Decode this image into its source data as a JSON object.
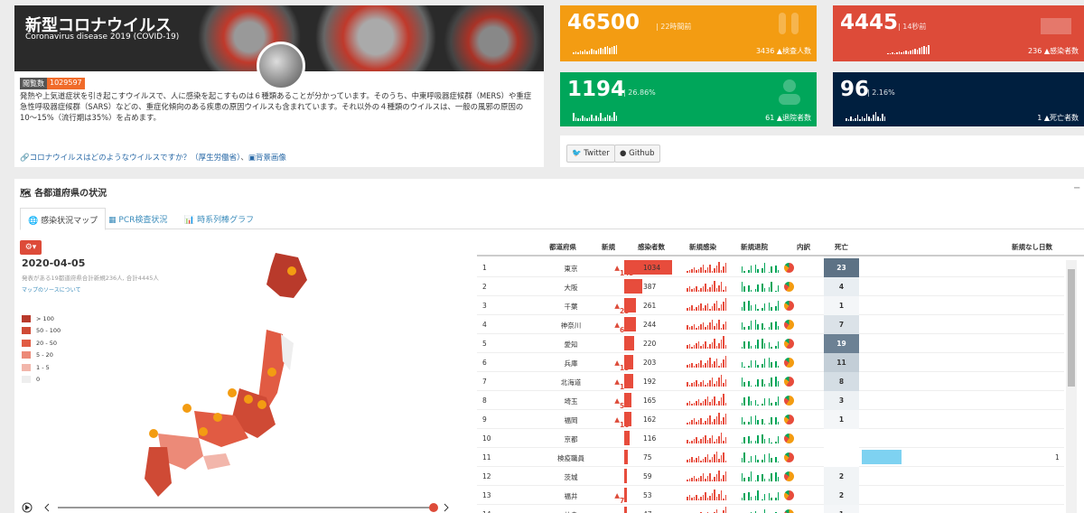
{
  "header": {
    "title": "新型コロナウイルス",
    "subtitle": "Coronavirus disease 2019 (COVID-19)",
    "views_label": "閲覧数",
    "views_count": "1029597",
    "description": "発熱や上気道症状を引き起こすウイルスで、人に感染を起こすものは６種類あることが分かっています。そのうち、中東呼吸器症候群（MERS）や重症急性呼吸器症候群（SARS）などの、重症化傾向のある疾患の原因ウイルスも含まれています。それ以外の４種類のウイルスは、一般の風邪の原因の10〜15%（流行期は35%）を占めます。",
    "link1": "コロナウイルスはどのようなウイルスですか？（厚生労働省）",
    "sep": "、",
    "link2": "背景画像"
  },
  "stats": [
    {
      "value": "46500",
      "sub": "22時間前",
      "foot_num": "3436",
      "foot_label": "検査人数",
      "color": "#f39c12",
      "spark": [
        2,
        3,
        2,
        4,
        3,
        5,
        3,
        4,
        6,
        5,
        4,
        6,
        7,
        6,
        8,
        9,
        7,
        8,
        9,
        10
      ]
    },
    {
      "value": "4445",
      "sub": "14秒前",
      "foot_num": "236",
      "foot_label": "感染者数",
      "color": "#dd4b39",
      "spark": [
        1,
        1,
        2,
        1,
        2,
        3,
        2,
        3,
        4,
        3,
        4,
        5,
        6,
        5,
        7,
        8,
        9,
        8,
        10
      ]
    },
    {
      "value": "1194",
      "sub": "26.86%",
      "foot_num": "61",
      "foot_label": "退院者数",
      "color": "#00a65a",
      "spark": [
        6,
        3,
        2,
        2,
        4,
        3,
        2,
        3,
        5,
        2,
        4,
        3,
        6,
        2,
        3,
        5,
        4,
        3,
        7,
        4
      ]
    },
    {
      "value": "96",
      "sub": "2.16%",
      "foot_num": "1",
      "foot_label": "死亡者数",
      "color": "#001f3f",
      "spark": [
        2,
        1,
        3,
        1,
        2,
        4,
        1,
        3,
        2,
        5,
        3,
        2,
        4,
        6,
        3,
        2,
        5,
        3
      ]
    }
  ],
  "social": {
    "twitter": "Twitter",
    "github": "Github"
  },
  "panel": {
    "title": "各都道府県の状況",
    "tabs": [
      "感染状況マップ",
      "PCR検査状況",
      "時系列棒グラフ"
    ],
    "minimize": "−"
  },
  "map": {
    "date": "2020-04-05",
    "desc": "発表がある19都道府県合計新規236人, 合計4445人",
    "source_link": "マップのソースについて",
    "gear": "⚙▾",
    "legend": [
      {
        "label": "> 100",
        "color": "#b93a2b"
      },
      {
        "label": "50 - 100",
        "color": "#cf4a35"
      },
      {
        "label": "20 - 50",
        "color": "#e15b43"
      },
      {
        "label": "5 - 20",
        "color": "#ec8a78"
      },
      {
        "label": "1 - 5",
        "color": "#f2b6ab"
      },
      {
        "label": "0",
        "color": "#eeeeee"
      }
    ]
  },
  "table": {
    "headers": {
      "pref": "都道府県",
      "new": "新規",
      "cases": "感染者数",
      "new_cases": "新規感染",
      "new_discharge": "新規退院",
      "breakdown": "内訳",
      "deaths": "死亡",
      "days_without": "新規なし日数"
    },
    "rows": [
      {
        "rank": "1",
        "pref": "東京",
        "new": "143",
        "cases": "1034",
        "cases_num": 1034,
        "deaths": "23",
        "death_shade": "#5d7285",
        "death_color": "#fff"
      },
      {
        "rank": "2",
        "pref": "大阪",
        "new": "",
        "cases": "387",
        "cases_num": 387,
        "deaths": "4",
        "death_shade": "#e9eef2",
        "death_color": "#333"
      },
      {
        "rank": "3",
        "pref": "千葉",
        "new": "25",
        "cases": "261",
        "cases_num": 261,
        "deaths": "1",
        "death_shade": "#f4f6f8",
        "death_color": "#333"
      },
      {
        "rank": "4",
        "pref": "神奈川",
        "new": "6",
        "cases": "244",
        "cases_num": 244,
        "deaths": "7",
        "death_shade": "#dbe2e8",
        "death_color": "#333"
      },
      {
        "rank": "5",
        "pref": "愛知",
        "new": "",
        "cases": "220",
        "cases_num": 220,
        "deaths": "19",
        "death_shade": "#6c8194",
        "death_color": "#fff"
      },
      {
        "rank": "6",
        "pref": "兵庫",
        "new": "13",
        "cases": "203",
        "cases_num": 203,
        "deaths": "11",
        "death_shade": "#c3ced7",
        "death_color": "#333"
      },
      {
        "rank": "7",
        "pref": "北海道",
        "new": "1",
        "cases": "192",
        "cases_num": 192,
        "deaths": "8",
        "death_shade": "#d4dde4",
        "death_color": "#333"
      },
      {
        "rank": "8",
        "pref": "埼玉",
        "new": "5",
        "cases": "165",
        "cases_num": 165,
        "deaths": "3",
        "death_shade": "#edf1f4",
        "death_color": "#333"
      },
      {
        "rank": "9",
        "pref": "福岡",
        "new": "16",
        "cases": "162",
        "cases_num": 162,
        "deaths": "1",
        "death_shade": "#f4f6f8",
        "death_color": "#333"
      },
      {
        "rank": "10",
        "pref": "京都",
        "new": "",
        "cases": "116",
        "cases_num": 116,
        "deaths": "",
        "death_shade": "#fff",
        "death_color": "#333"
      },
      {
        "rank": "11",
        "pref": "検疫職員",
        "new": "",
        "cases": "75",
        "cases_num": 75,
        "deaths": "",
        "death_shade": "#fff",
        "death_color": "#333",
        "no_new_days": "1"
      },
      {
        "rank": "12",
        "pref": "茨城",
        "new": "",
        "cases": "59",
        "cases_num": 59,
        "deaths": "2",
        "death_shade": "#f1f4f6",
        "death_color": "#333"
      },
      {
        "rank": "13",
        "pref": "福井",
        "new": "7",
        "cases": "53",
        "cases_num": 53,
        "deaths": "2",
        "death_shade": "#f1f4f6",
        "death_color": "#333"
      },
      {
        "rank": "14",
        "pref": "岐阜",
        "new": "",
        "cases": "47",
        "cases_num": 47,
        "deaths": "1",
        "death_shade": "#f4f6f8",
        "death_color": "#333"
      }
    ]
  }
}
